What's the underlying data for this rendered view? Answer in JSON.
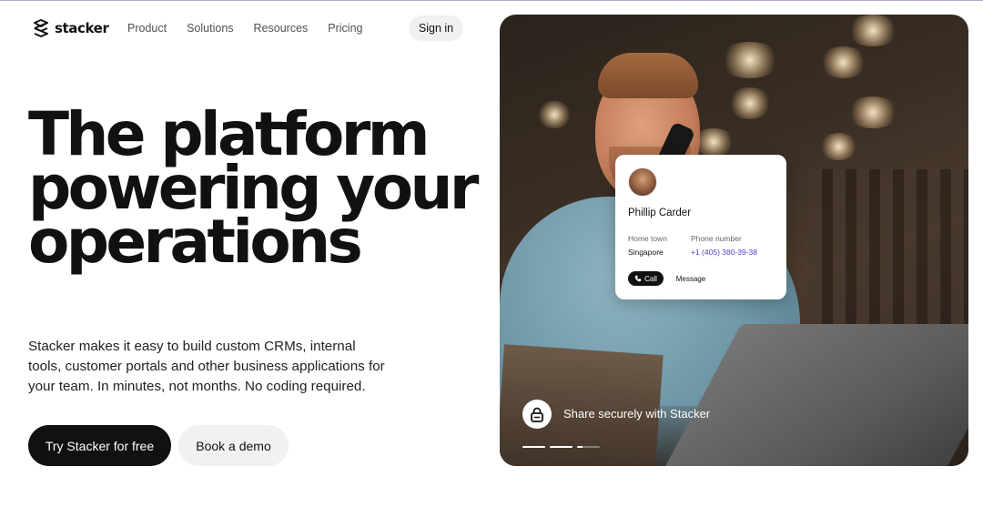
{
  "brand": {
    "name": "stacker"
  },
  "nav": {
    "items": [
      "Product",
      "Solutions",
      "Resources",
      "Pricing"
    ],
    "sign_in": "Sign in"
  },
  "hero": {
    "headline_lines": [
      "The platform",
      "powering your",
      "operations"
    ],
    "subtext": "Stacker makes it easy to build custom CRMs, internal tools, customer portals and other business applications for your team. In minutes, not months. No coding required.",
    "primary_cta": "Try Stacker for free",
    "secondary_cta": "Book a demo"
  },
  "contact_card": {
    "name": "Phillip Carder",
    "hometown_label": "Home town",
    "hometown_value": "Singapore",
    "phone_label": "Phone number",
    "phone_value": "+1 (405) 380-39-38",
    "call_label": "Call",
    "message_label": "Message"
  },
  "slide": {
    "caption": "Share securely with Stacker",
    "icon": "lock-icon",
    "progress": [
      1,
      1,
      0.25
    ]
  },
  "colors": {
    "primary": "#111111",
    "phone_link": "#5a3fd1",
    "secondary_button": "#f1f1f1"
  }
}
